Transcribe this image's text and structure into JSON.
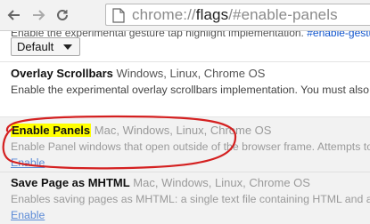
{
  "browser": {
    "url_scheme": "chrome://",
    "url_host": "flags",
    "url_path": "/#enable-panels",
    "icons": [
      "back-arrow-icon",
      "forward-arrow-icon",
      "reload-icon",
      "page-icon"
    ]
  },
  "page": {
    "partial_text": "Enable the experimental gesture tap highlight implementation.",
    "partial_link": "#enable-gesture-tap-",
    "select_value": "Default",
    "flags": [
      {
        "name": "Overlay Scrollbars",
        "platforms": "Windows, Linux, Chrome OS",
        "description": "Enable the experimental overlay scrollbars implementation. You must also enable threa",
        "state": "enabled"
      },
      {
        "name": "Enable Panels",
        "platforms": "Mac, Windows, Linux, Chrome OS",
        "description": "Enable Panel windows that open outside of the browser frame. Attempts to open a Pan",
        "link": "Enable",
        "state": "disabled",
        "highlight_color": "#ffff00"
      },
      {
        "name": "Save Page as MHTML",
        "platforms": "Mac, Windows, Linux, Chrome OS",
        "description": "Enables saving pages as MHTML: a single text file containing HTML and all sub-resour",
        "link": "Enable",
        "state": "disabled"
      }
    ],
    "annotation_color": "#d42020"
  }
}
